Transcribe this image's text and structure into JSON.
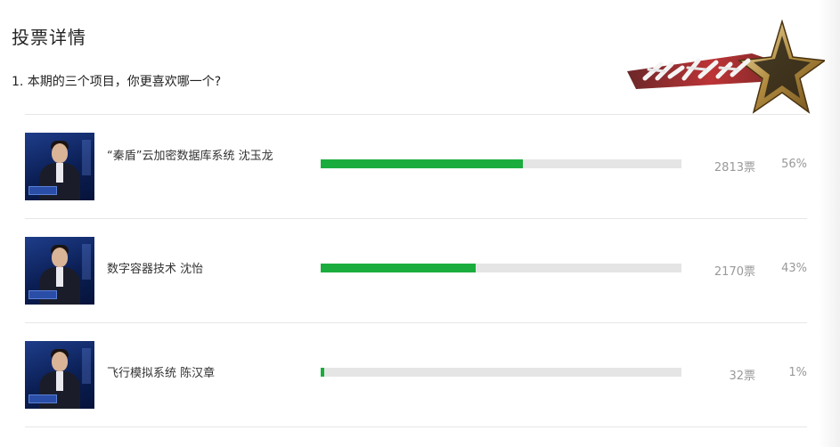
{
  "page": {
    "title": "投票详情"
  },
  "question": {
    "text": "1. 本期的三个项目，你更喜欢哪一个?"
  },
  "logo": {
    "alt_name": "创业英雄汇"
  },
  "options": [
    {
      "name": "“秦盾”云加密数据库系统 沈玉龙",
      "votes": "2813票",
      "percent": "56%",
      "percent_value": 56
    },
    {
      "name": "数字容器技术 沈怡",
      "votes": "2170票",
      "percent": "43%",
      "percent_value": 43
    },
    {
      "name": "飞行模拟系统 陈汉章",
      "votes": "32票",
      "percent": "1%",
      "percent_value": 1
    }
  ],
  "colors": {
    "bar_fill": "#1aad3d",
    "bar_track": "#e5e5e5",
    "divider": "#e6e6e6"
  }
}
